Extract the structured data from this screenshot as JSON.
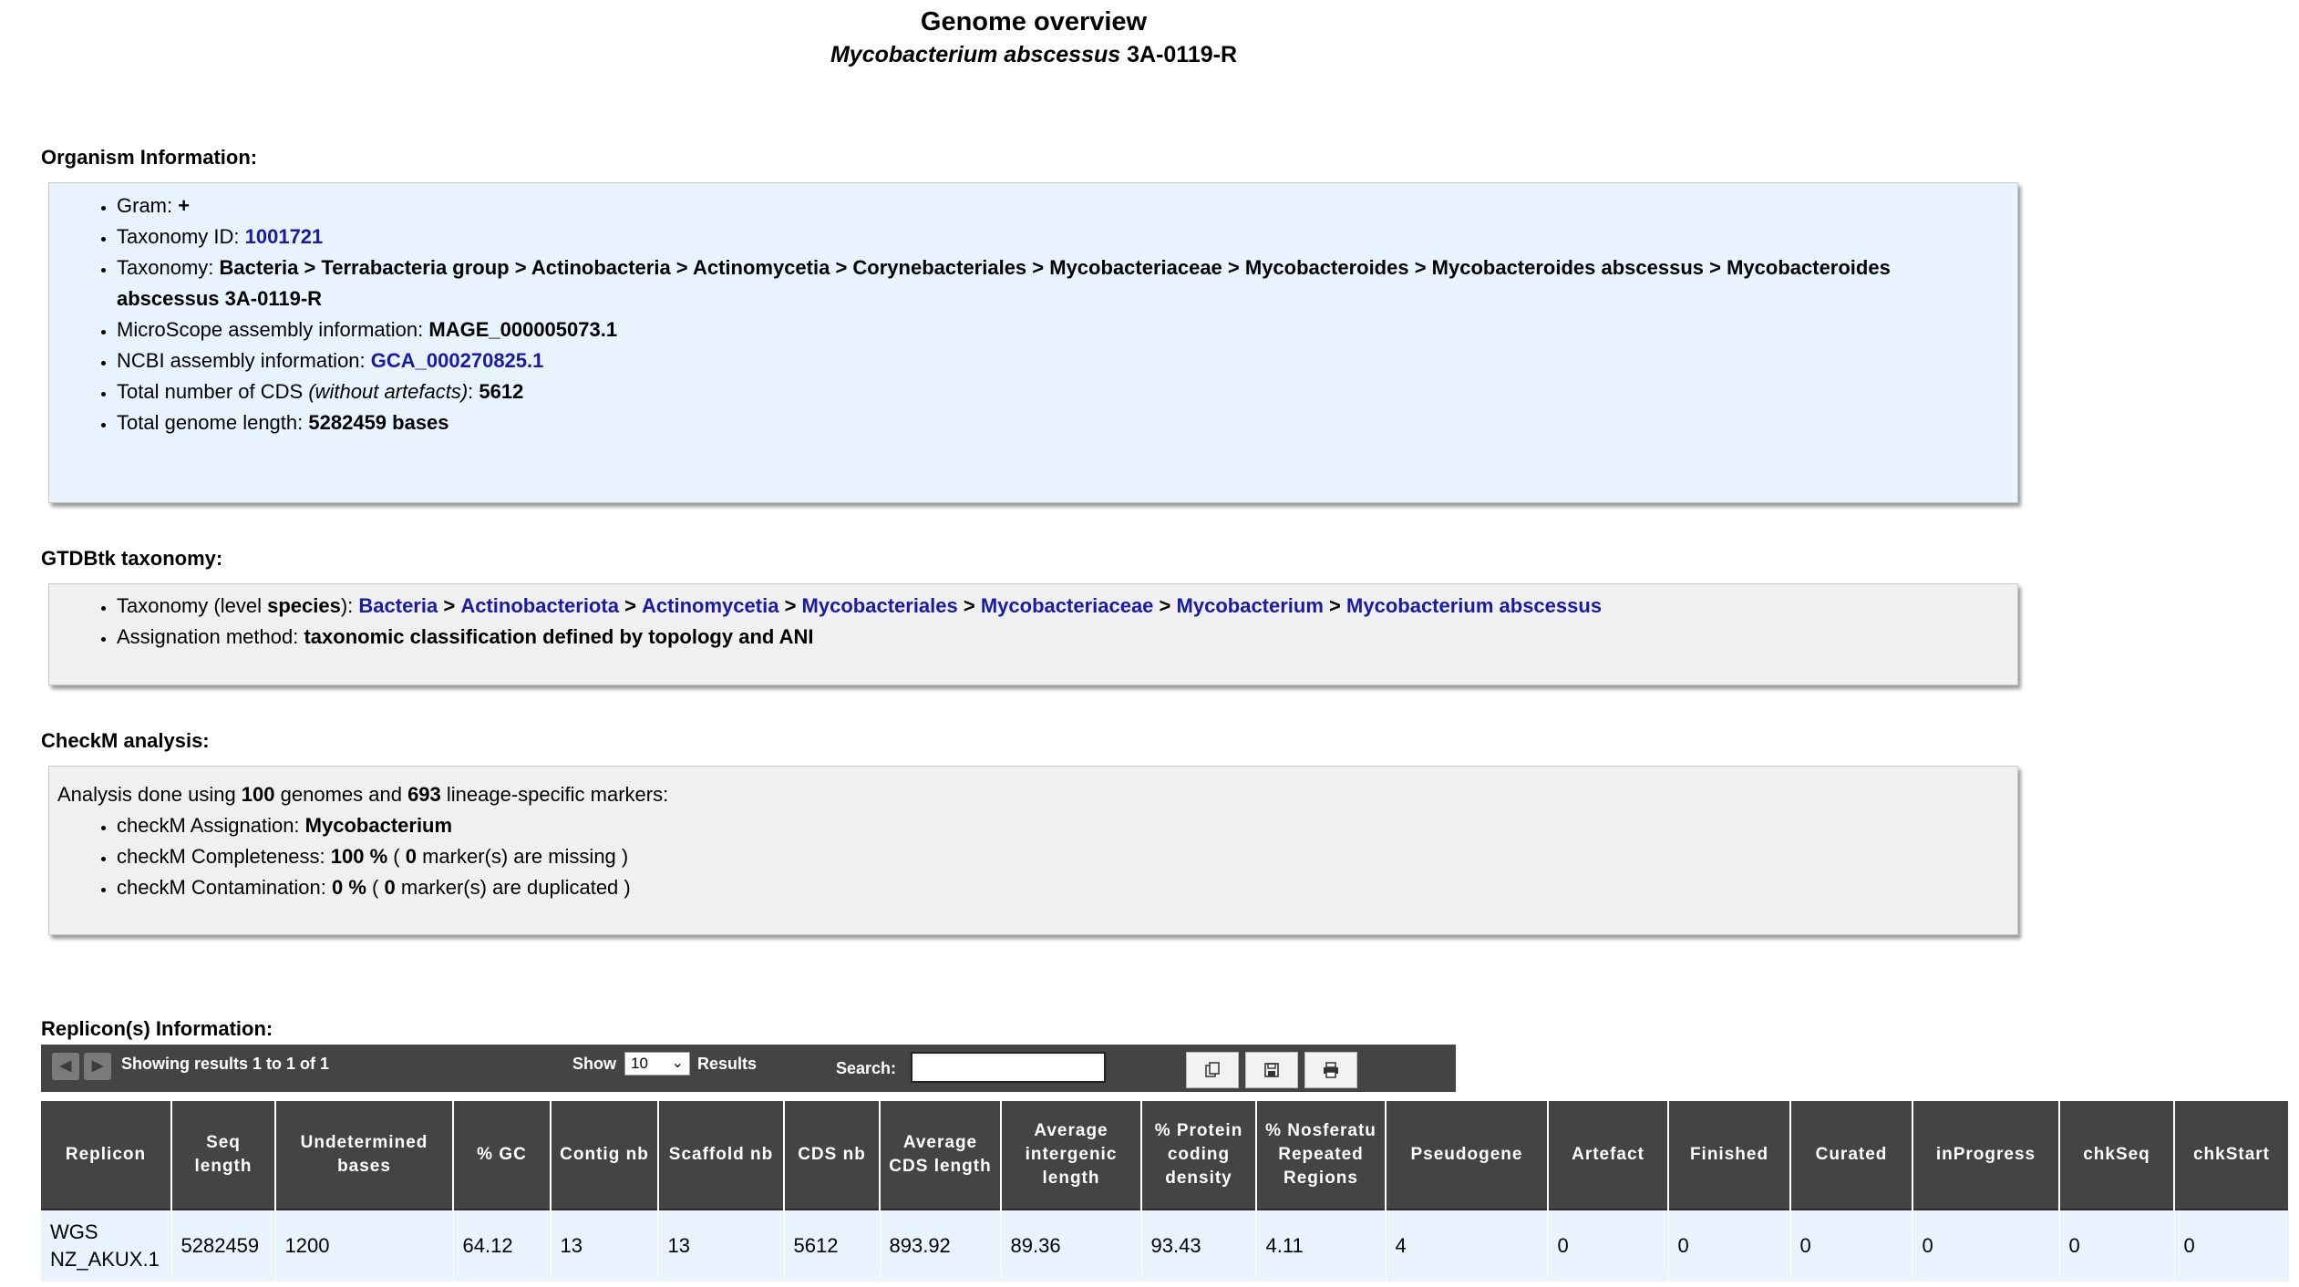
{
  "header": {
    "title": "Genome overview",
    "organism_italic": "Mycobacterium abscessus",
    "organism_strain": "3A-0119-R"
  },
  "organism_info": {
    "heading": "Organism Information:",
    "gram_label": "Gram:",
    "gram_value": "+",
    "taxid_label": "Taxonomy ID:",
    "taxid_value": "1001721",
    "taxonomy_label": "Taxonomy:",
    "taxonomy_value": "Bacteria > Terrabacteria group > Actinobacteria > Actinomycetia > Corynebacteriales > Mycobacteriaceae > Mycobacteroides > Mycobacteroides abscessus > Mycobacteroides abscessus 3A-0119-R",
    "microscope_label": "MicroScope assembly information:",
    "microscope_value": "MAGE_000005073.1",
    "ncbi_label": "NCBI assembly information:",
    "ncbi_value": "GCA_000270825.1",
    "cds_label_pre": "Total number of CDS ",
    "cds_label_it": "(without artefacts)",
    "cds_label_post": ":",
    "cds_value": "5612",
    "length_label": "Total genome length:",
    "length_value": "5282459 bases"
  },
  "gtdbtk": {
    "heading": "GTDBtk taxonomy:",
    "tax_label_pre": "Taxonomy (level ",
    "tax_label_level": "species",
    "tax_label_post": "):",
    "ranks": [
      "Bacteria",
      "Actinobacteriota",
      "Actinomycetia",
      "Mycobacteriales",
      "Mycobacteriaceae",
      "Mycobacterium",
      "Mycobacterium abscessus"
    ],
    "sep": ">",
    "method_label": "Assignation method:",
    "method_value": "taxonomic classification defined by topology and ANI"
  },
  "checkm": {
    "heading": "CheckM analysis:",
    "intro_pre": "Analysis done using ",
    "genomes": "100",
    "intro_mid": " genomes and ",
    "markers": "693",
    "intro_post": " lineage-specific markers:",
    "assign_label": "checkM Assignation:",
    "assign_value": "Mycobacterium",
    "complete_label": "checkM Completeness:",
    "complete_value": "100 %",
    "complete_mid_pre": " ( ",
    "complete_missing": "0",
    "complete_post": " marker(s) are missing )",
    "contam_label": "checkM Contamination:",
    "contam_value": "0 %",
    "contam_dup": "0",
    "contam_post": " marker(s) are duplicated )"
  },
  "replicons": {
    "heading": "Replicon(s) Information:",
    "showing": "Showing results 1 to 1 of 1",
    "show_label": "Show",
    "show_value": "10",
    "results_label": "Results",
    "search_label": "Search:",
    "search_value": "",
    "columns": [
      "Replicon",
      "Seq length",
      "Undetermined bases",
      "% GC",
      "Contig nb",
      "Scaffold nb",
      "CDS nb",
      "Average CDS length",
      "Average intergenic length",
      "% Protein coding density",
      "% Nosferatu Repeated Regions",
      "Pseudogene",
      "Artefact",
      "Finished",
      "Curated",
      "inProgress",
      "chkSeq",
      "chkStart"
    ],
    "rows": [
      [
        "WGS NZ_AKUX.1",
        "5282459",
        "1200",
        "64.12",
        "13",
        "13",
        "5612",
        "893.92",
        "89.36",
        "93.43",
        "4.11",
        "4",
        "0",
        "0",
        "0",
        "0",
        "0",
        "0"
      ]
    ]
  }
}
